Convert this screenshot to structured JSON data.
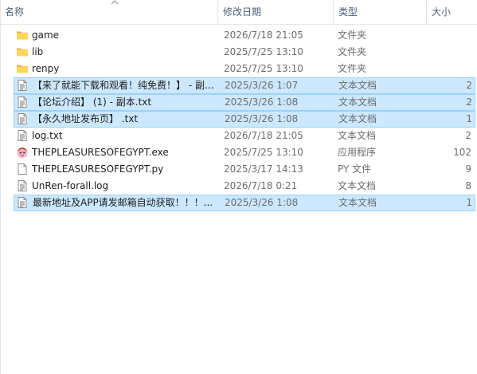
{
  "columns": {
    "name": "名称",
    "date": "修改日期",
    "type": "类型",
    "size": "大小"
  },
  "files": [
    {
      "name": "game",
      "date": "2026/7/18 21:05",
      "type": "文件夹",
      "size": "",
      "icon": "folder-icon",
      "selected": false
    },
    {
      "name": "lib",
      "date": "2025/7/25 13:10",
      "type": "文件夹",
      "size": "",
      "icon": "folder-icon",
      "selected": false
    },
    {
      "name": "renpy",
      "date": "2025/7/25 13:10",
      "type": "文件夹",
      "size": "",
      "icon": "folder-icon",
      "selected": false
    },
    {
      "name": "【来了就能下载和观看！纯免费！】 - 副...",
      "date": "2025/3/26 1:07",
      "type": "文本文档",
      "size": "2",
      "icon": "text-file-icon",
      "selected": true
    },
    {
      "name": "【论坛介绍】 (1) - 副本.txt",
      "date": "2025/3/26 1:08",
      "type": "文本文档",
      "size": "2",
      "icon": "text-file-icon",
      "selected": true
    },
    {
      "name": "【永久地址发布页】 .txt",
      "date": "2025/3/26 1:08",
      "type": "文本文档",
      "size": "1",
      "icon": "text-file-icon",
      "selected": true
    },
    {
      "name": "log.txt",
      "date": "2026/7/18 21:05",
      "type": "文本文档",
      "size": "2",
      "icon": "text-file-icon",
      "selected": false
    },
    {
      "name": "THEPLEASURESOFEGYPT.exe",
      "date": "2025/7/25 13:10",
      "type": "应用程序",
      "size": "102",
      "icon": "game-app-icon",
      "selected": false
    },
    {
      "name": "THEPLEASURESOFEGYPT.py",
      "date": "2025/3/17 14:13",
      "type": "PY 文件",
      "size": "9",
      "icon": "blank-file-icon",
      "selected": false
    },
    {
      "name": "UnRen-forall.log",
      "date": "2026/7/18 0:21",
      "type": "文本文档",
      "size": "8",
      "icon": "text-file-icon",
      "selected": false
    },
    {
      "name": "最新地址及APP请发邮箱自动获取！！！...",
      "date": "2025/3/26 1:08",
      "type": "文本文档",
      "size": "1",
      "icon": "text-file-icon",
      "selected": true
    }
  ],
  "colors": {
    "selection_fill": "#cce8ff",
    "selection_border": "#99d1ff",
    "header_text": "#4c607a",
    "folder": "#ffd65c"
  }
}
